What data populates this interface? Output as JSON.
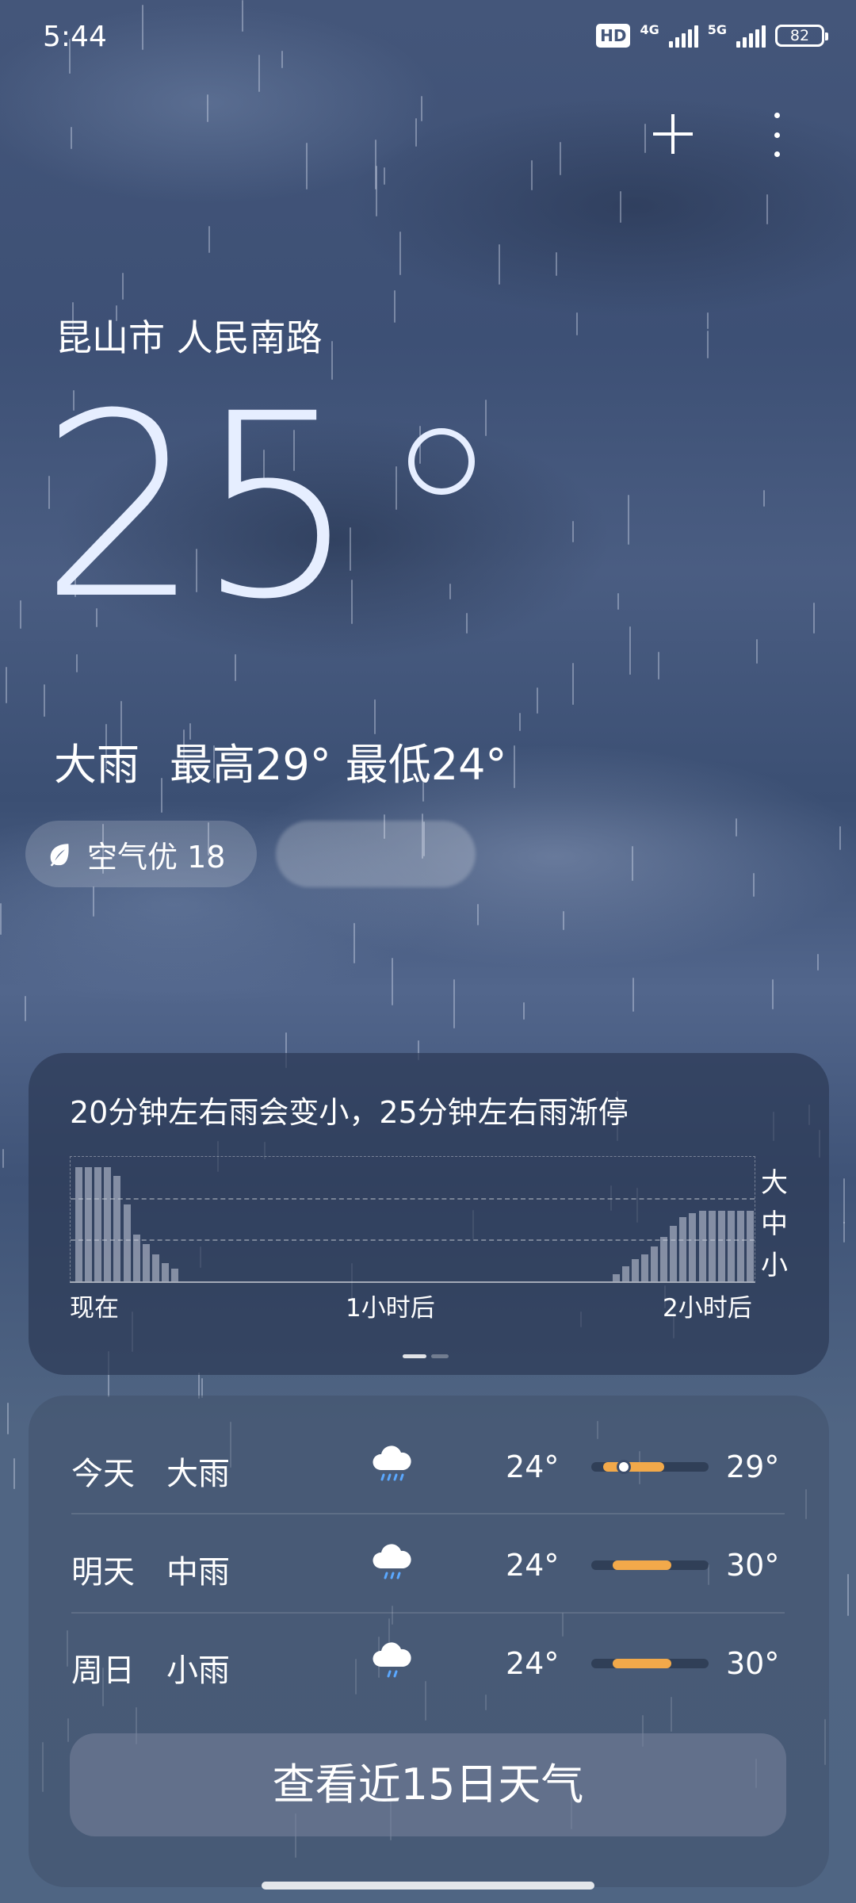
{
  "status_bar": {
    "time": "5:44",
    "hd_label": "HD",
    "network1": "4G",
    "network2": "5G",
    "battery": "82"
  },
  "location": "昆山市 人民南路",
  "current": {
    "temperature": "25",
    "condition": "大雨",
    "high": "最高29°",
    "low": "最低24°",
    "air_quality": "空气优 18"
  },
  "minute_rain": {
    "summary": "20分钟左右雨会变小，25分钟左右雨渐停",
    "y_levels": [
      "大",
      "中",
      "小"
    ],
    "x_labels": [
      "现在",
      "1小时后",
      "2小时后"
    ],
    "intensity": [
      0.92,
      0.92,
      0.92,
      0.92,
      0.85,
      0.62,
      0.38,
      0.3,
      0.22,
      0.15,
      0.1,
      0,
      0,
      0,
      0,
      0,
      0,
      0,
      0,
      0,
      0,
      0,
      0,
      0,
      0,
      0,
      0,
      0,
      0,
      0,
      0,
      0,
      0,
      0,
      0,
      0,
      0,
      0,
      0,
      0,
      0,
      0,
      0,
      0,
      0,
      0,
      0,
      0,
      0,
      0,
      0,
      0,
      0,
      0,
      0,
      0,
      0.06,
      0.12,
      0.18,
      0.22,
      0.28,
      0.36,
      0.45,
      0.52,
      0.55,
      0.57,
      0.57,
      0.57,
      0.57,
      0.57,
      0.57
    ]
  },
  "forecast": [
    {
      "day": "今天",
      "condition": "大雨",
      "icon": "heavy-rain-icon",
      "low": "24°",
      "high": "29°",
      "bar_start": 0.1,
      "bar_end": 0.62,
      "current_pos": 0.28
    },
    {
      "day": "明天",
      "condition": "中雨",
      "icon": "moderate-rain-icon",
      "low": "24°",
      "high": "30°",
      "bar_start": 0.18,
      "bar_end": 0.68
    },
    {
      "day": "周日",
      "condition": "小雨",
      "icon": "light-rain-icon",
      "low": "24°",
      "high": "30°",
      "bar_start": 0.18,
      "bar_end": 0.68
    }
  ],
  "view_15_days": "查看近15日天气",
  "colors": {
    "accent_bar": "#f2a94a",
    "icon_drop": "#5aa8ff"
  }
}
